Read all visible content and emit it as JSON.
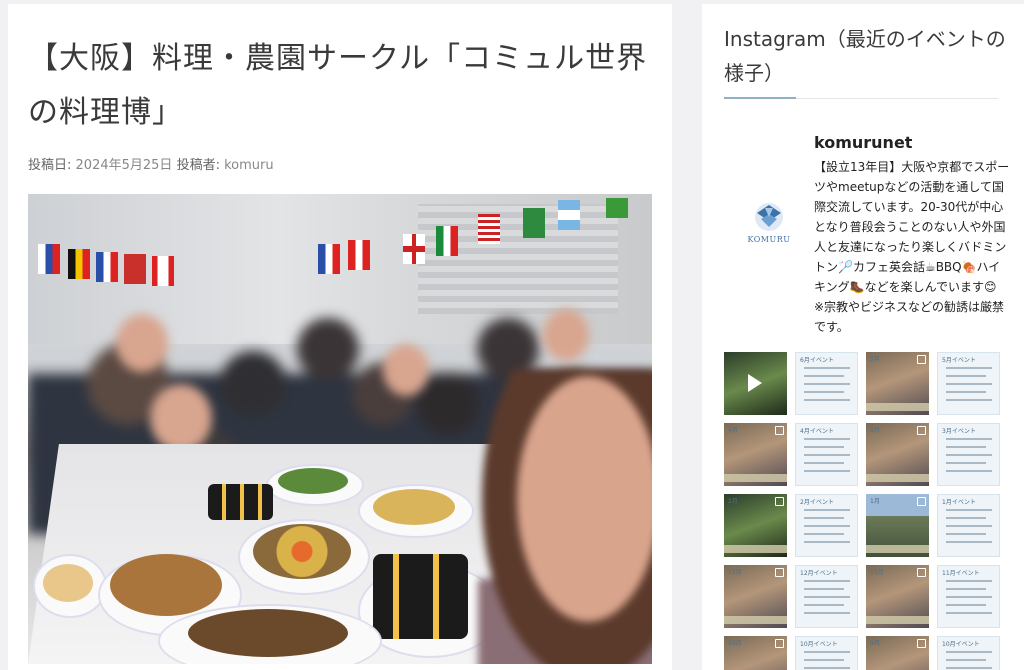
{
  "post": {
    "title": "【大阪】料理・農園サークル「コミュル世界の料理博」",
    "meta_posted_label": "投稿日:",
    "meta_date": "2024年5月25日",
    "meta_author_label": "投稿者:",
    "meta_author": "komuru"
  },
  "sidebar": {
    "widget_title": "Instagram（最近のイベントの様子）",
    "instagram": {
      "username": "komurunet",
      "logo_text": "KOMURU",
      "bio": "【設立13年目】大阪や京都でスポーツやmeetupなどの活動を通して国際交流しています。20-30代が中心となり普段会うことのない人や外国人と友達になったり楽しくバドミントン🏸カフェ英会話☕BBQ🍖ハイキング🥾などを楽しんでいます😊 ※宗教やビジネスなどの勧誘は厳禁です。",
      "posts": [
        {
          "type": "video",
          "style": "green",
          "caption": ""
        },
        {
          "type": "text",
          "style": "text-post",
          "caption": "6月イベント"
        },
        {
          "type": "photo",
          "style": "photo-post",
          "caption": "5月"
        },
        {
          "type": "text",
          "style": "text-post",
          "caption": "5月イベント"
        },
        {
          "type": "photo",
          "style": "photo-post",
          "caption": "4月"
        },
        {
          "type": "text",
          "style": "text-post",
          "caption": "4月イベント"
        },
        {
          "type": "photo",
          "style": "photo-post",
          "caption": "3月"
        },
        {
          "type": "text",
          "style": "text-post",
          "caption": "3月イベント"
        },
        {
          "type": "photo",
          "style": "green",
          "caption": "2月"
        },
        {
          "type": "text",
          "style": "text-post",
          "caption": "2月イベント"
        },
        {
          "type": "photo",
          "style": "sky",
          "caption": "1月"
        },
        {
          "type": "text",
          "style": "text-post",
          "caption": "1月イベント"
        },
        {
          "type": "photo",
          "style": "photo-post",
          "caption": "12月"
        },
        {
          "type": "text",
          "style": "text-post",
          "caption": "12月イベント"
        },
        {
          "type": "photo",
          "style": "photo-post",
          "caption": "11月"
        },
        {
          "type": "text",
          "style": "text-post",
          "caption": "11月イベント"
        },
        {
          "type": "photo",
          "style": "photo-post",
          "caption": "10月"
        },
        {
          "type": "text",
          "style": "text-post",
          "caption": "10月イベント"
        },
        {
          "type": "photo",
          "style": "photo-post",
          "caption": "9月"
        },
        {
          "type": "text",
          "style": "text-post",
          "caption": "10月イベント"
        }
      ]
    }
  },
  "colors": {
    "accent_underline": "#8fb3c4",
    "logo_blue": "#3d72a8"
  }
}
